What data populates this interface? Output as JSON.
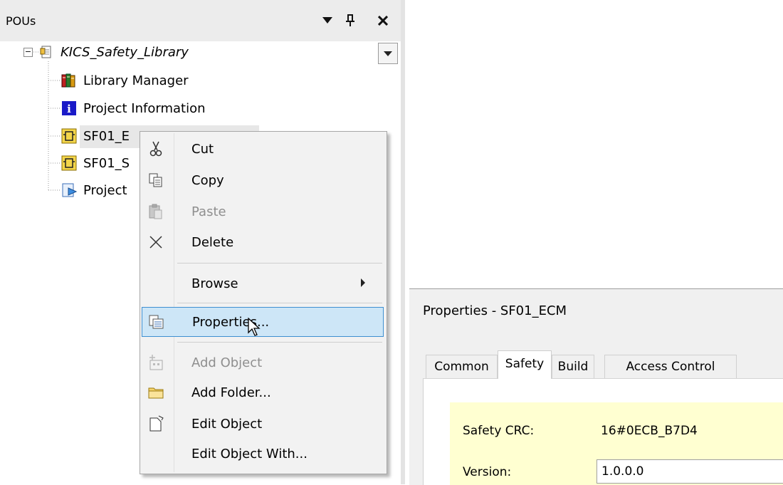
{
  "pou_pane": {
    "title": "POUs",
    "header_buttons": [
      {
        "icon": "dropdown-arrow-icon",
        "glyph": "▼"
      },
      {
        "icon": "pin-icon",
        "glyph": "ᵩ"
      },
      {
        "icon": "close-icon",
        "glyph": "✕"
      }
    ],
    "tree": [
      {
        "label": "KICS_Safety_Library",
        "icon": "library-project-icon",
        "italic": true
      },
      {
        "label": "Library Manager",
        "icon": "books-icon"
      },
      {
        "label": "Project Information",
        "icon": "info-icon"
      },
      {
        "label": "SF01_E",
        "icon": "function-block-icon"
      },
      {
        "label": "SF01_S",
        "icon": "function-block-icon"
      },
      {
        "label": "Project",
        "icon": "project-settings-icon"
      }
    ]
  },
  "context_menu": {
    "items": [
      {
        "label": "Cut",
        "icon": "scissors-icon",
        "enabled": true
      },
      {
        "label": "Copy",
        "icon": "copy-icon",
        "enabled": true
      },
      {
        "label": "Paste",
        "icon": "paste-icon",
        "enabled": false
      },
      {
        "label": "Delete",
        "icon": "delete-x-icon",
        "enabled": true
      },
      {
        "label": "Browse",
        "icon": "none",
        "enabled": true,
        "submenu": true
      },
      {
        "label": "Properties...",
        "icon": "properties-icon",
        "enabled": true,
        "highlighted": true
      },
      {
        "label": "Add Object",
        "icon": "add-object-icon",
        "enabled": false
      },
      {
        "label": "Add Folder...",
        "icon": "folder-icon",
        "enabled": true
      },
      {
        "label": "Edit Object",
        "icon": "edit-object-icon",
        "enabled": true
      },
      {
        "label": "Edit Object With...",
        "icon": "none",
        "enabled": true
      }
    ]
  },
  "properties": {
    "title": "Properties - SF01_ECM",
    "tabs": [
      {
        "label": "Common",
        "active": false
      },
      {
        "label": "Safety",
        "active": true
      },
      {
        "label": "Build",
        "active": false
      },
      {
        "label": "Access Control",
        "active": false
      }
    ],
    "safety_crc_label": "Safety CRC:",
    "safety_crc_value": "16#0ECB_B7D4",
    "version_label": "Version:",
    "version_value": "1.0.0.0"
  },
  "colors": {
    "menu_highlight": "#cde6f7",
    "menu_highlight_border": "#3e8fd1",
    "safety_panel": "#ffffd1"
  }
}
